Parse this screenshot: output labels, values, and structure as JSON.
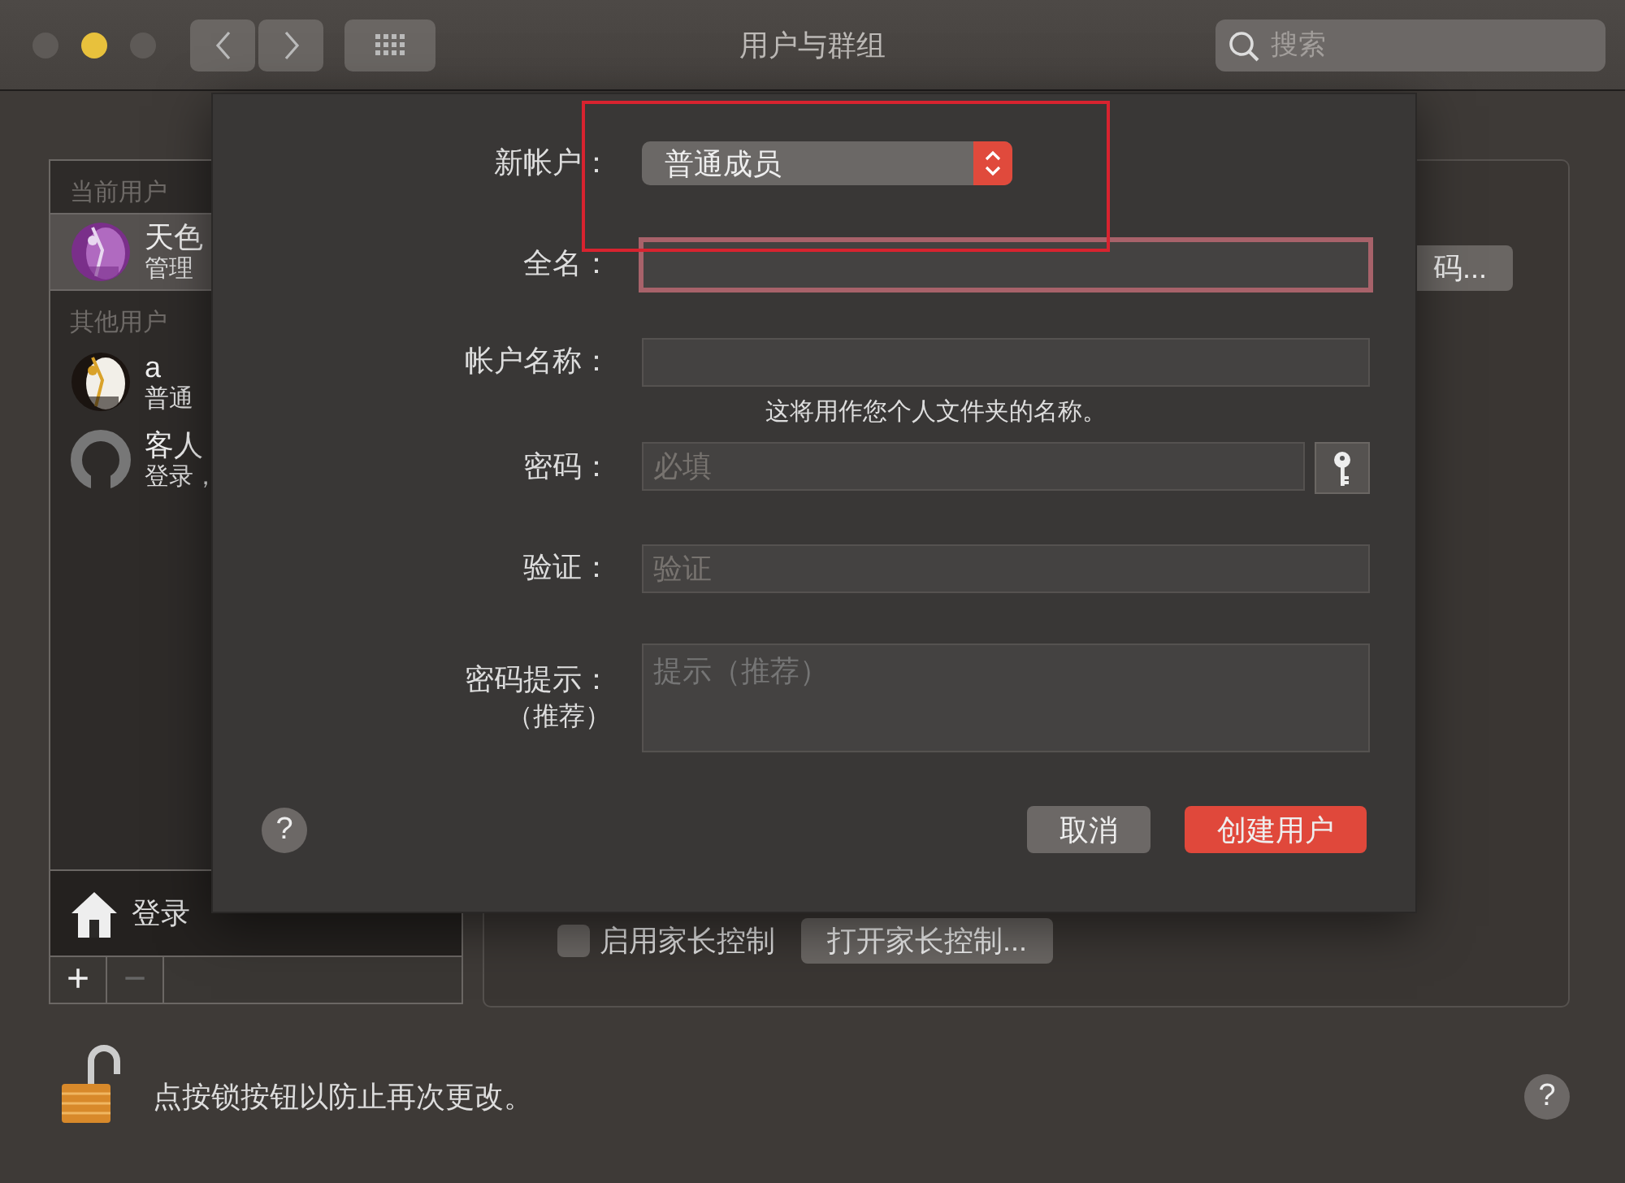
{
  "window": {
    "title": "用户与群组",
    "search": {
      "placeholder": "搜索"
    }
  },
  "sidebar": {
    "sections": [
      {
        "heading": "当前用户",
        "users": [
          {
            "name": "天色",
            "role": "管理",
            "selected": true
          }
        ]
      },
      {
        "heading": "其他用户",
        "users": [
          {
            "name": "a",
            "role": "普通",
            "selected": false
          },
          {
            "name": "客人",
            "role": "登录，",
            "avatar": {
              "kind": "silhouette"
            },
            "selected": false
          }
        ]
      }
    ],
    "login_options": "登录",
    "add_button": {
      "label": "+",
      "disabled": false
    },
    "remove_button": {
      "label": "−",
      "disabled": true
    }
  },
  "panel": {
    "password_button": "码...",
    "parental": {
      "label": "启用家长控制",
      "checked": false
    },
    "open_parental_button": "打开家长控制..."
  },
  "sheet": {
    "account_type": {
      "label": "新帐户：",
      "value": "普通成员"
    },
    "fields": [
      {
        "kind": "text",
        "label": "全名：",
        "focused": true
      },
      {
        "kind": "text",
        "label": "帐户名称：",
        "focused": false,
        "note": "这将用作您个人文件夹的名称。"
      },
      {
        "kind": "password",
        "label": "密码：",
        "placeholder": "必填",
        "focused": false
      },
      {
        "kind": "text",
        "label": "验证：",
        "placeholder": "验证",
        "focused": false
      },
      {
        "kind": "multiline",
        "label": "密码提示：",
        "sublabel": "（推荐）",
        "placeholder": "提示（推荐）",
        "focused": false
      }
    ],
    "help": "?",
    "buttons": [
      {
        "label": "取消",
        "kind": "normal"
      },
      {
        "label": "创建用户",
        "kind": "default"
      }
    ]
  },
  "lock": {
    "text": "点按锁按钮以防止再次更改。",
    "locked": false
  },
  "help": "?"
}
